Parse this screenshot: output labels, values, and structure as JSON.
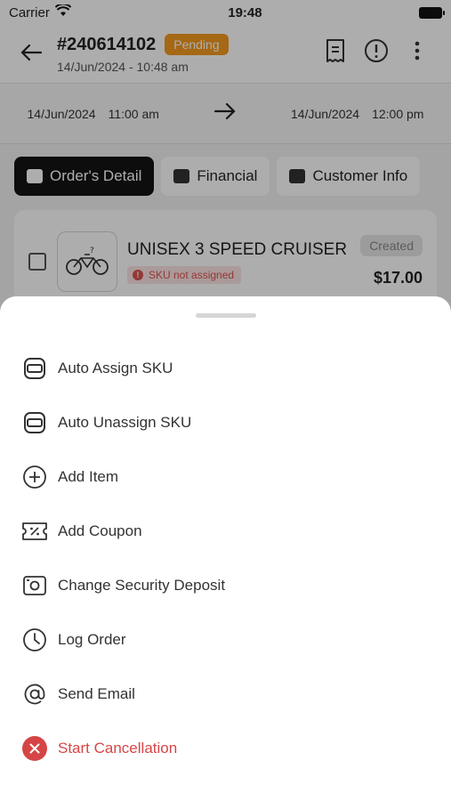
{
  "status_bar": {
    "carrier": "Carrier",
    "time": "19:48"
  },
  "header": {
    "order_id": "#240614102",
    "status": "Pending",
    "date": "14/Jun/2024 - 10:48 am"
  },
  "schedule": {
    "start_date": "14/Jun/2024",
    "start_time": "11:00 am",
    "end_date": "14/Jun/2024",
    "end_time": "12:00 pm"
  },
  "tabs": [
    {
      "label": "Order's Detail",
      "active": true
    },
    {
      "label": "Financial",
      "active": false
    },
    {
      "label": "Customer Info",
      "active": false
    }
  ],
  "item": {
    "name": "UNISEX 3 SPEED CRUISER",
    "sku_status": "SKU not assigned",
    "state": "Created",
    "price": "$17.00"
  },
  "actions": [
    {
      "label": "Auto Assign SKU",
      "icon": "sku-assign-icon"
    },
    {
      "label": "Auto Unassign SKU",
      "icon": "sku-unassign-icon"
    },
    {
      "label": "Add Item",
      "icon": "plus-circle-icon"
    },
    {
      "label": "Add Coupon",
      "icon": "coupon-icon"
    },
    {
      "label": "Change Security Deposit",
      "icon": "deposit-icon"
    },
    {
      "label": "Log Order",
      "icon": "clock-icon"
    },
    {
      "label": "Send Email",
      "icon": "at-icon"
    },
    {
      "label": "Start Cancellation",
      "icon": "cancel-icon"
    }
  ],
  "colors": {
    "pending": "#f39a1e",
    "danger": "#d64545",
    "active_tab": "#141414"
  }
}
